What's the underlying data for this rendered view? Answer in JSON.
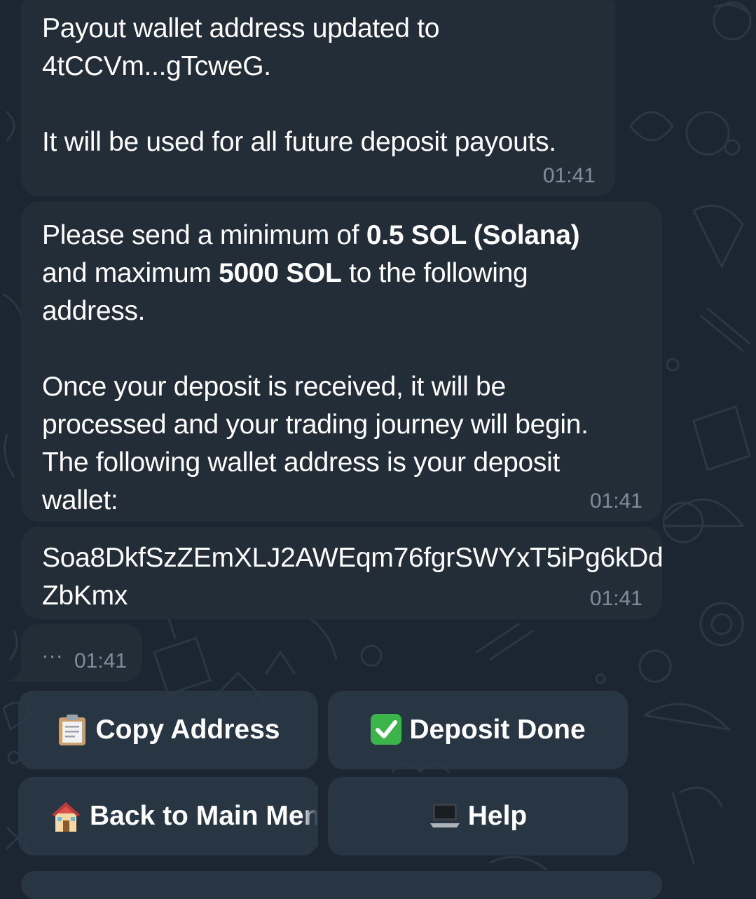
{
  "messages": [
    {
      "line1": "Payout wallet address updated to",
      "line2": "4tCCVm...gTcweG.",
      "line3": "It will be used for all future deposit payouts.",
      "time": "01:41"
    },
    {
      "p1_a": "Please send a minimum of ",
      "p1_b": "0.5 SOL (Solana)",
      "p1_c": "and maximum ",
      "p1_d": "5000 SOL",
      "p1_e": " to the following",
      "p1_f": "address.",
      "p2_1": "Once your deposit is received, it will be",
      "p2_2": "processed and your trading journey will begin.",
      "p2_3": "The following wallet address is your deposit",
      "p2_4": "wallet:",
      "time": "01:41"
    },
    {
      "line1": "Soa8DkfSzZEmXLJ2AWEqm76fgrSWYxT5iPg6kDd",
      "line2": "ZbKmx",
      "time": "01:41"
    },
    {
      "dots": "...",
      "time": "01:41"
    }
  ],
  "keyboard": {
    "copy_address": {
      "label": "Copy Address",
      "icon": "clipboard-icon"
    },
    "deposit_done": {
      "label": "Deposit Done",
      "icon": "check-mark-icon"
    },
    "back_to_menu": {
      "label": "Back to Main Menu",
      "icon": "house-icon"
    },
    "help": {
      "label": "Help",
      "icon": "laptop-icon"
    }
  },
  "colors": {
    "background": "#1b2632",
    "bubble": "#222d38",
    "timestamp": "#7f8d9b",
    "button": "#2c3a48"
  }
}
